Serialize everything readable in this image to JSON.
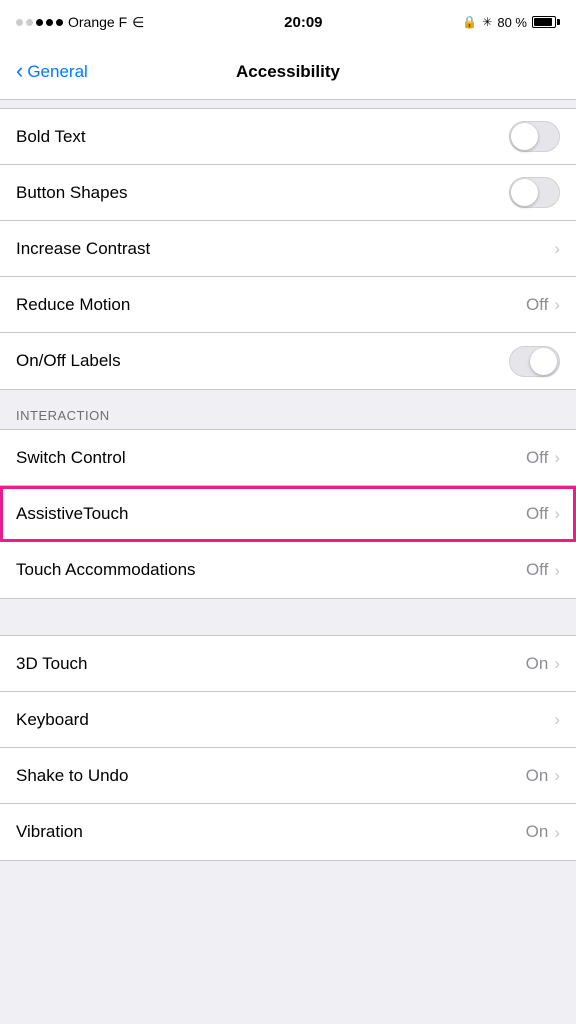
{
  "statusBar": {
    "carrier": "Orange F",
    "time": "20:09",
    "battery": "80 %",
    "batteryPercent": 80
  },
  "navBar": {
    "backLabel": "General",
    "title": "Accessibility"
  },
  "sections": [
    {
      "id": "vision",
      "header": null,
      "items": [
        {
          "id": "bold-text",
          "label": "Bold Text",
          "type": "toggle",
          "value": false,
          "valueLabel": null
        },
        {
          "id": "button-shapes",
          "label": "Button Shapes",
          "type": "toggle",
          "value": false,
          "valueLabel": null
        },
        {
          "id": "increase-contrast",
          "label": "Increase Contrast",
          "type": "chevron",
          "value": null,
          "valueLabel": null
        },
        {
          "id": "reduce-motion",
          "label": "Reduce Motion",
          "type": "chevron",
          "value": null,
          "valueLabel": "Off"
        },
        {
          "id": "onoff-labels",
          "label": "On/Off Labels",
          "type": "toggle-partial",
          "value": false,
          "valueLabel": null
        }
      ]
    },
    {
      "id": "interaction",
      "header": "INTERACTION",
      "items": [
        {
          "id": "switch-control",
          "label": "Switch Control",
          "type": "chevron",
          "value": null,
          "valueLabel": "Off"
        },
        {
          "id": "assistive-touch",
          "label": "AssistiveTouch",
          "type": "chevron",
          "value": null,
          "valueLabel": "Off",
          "highlighted": true
        },
        {
          "id": "touch-accommodations",
          "label": "Touch Accommodations",
          "type": "chevron",
          "value": null,
          "valueLabel": "Off"
        }
      ]
    },
    {
      "id": "physical",
      "header": null,
      "items": [
        {
          "id": "3d-touch",
          "label": "3D Touch",
          "type": "chevron",
          "value": null,
          "valueLabel": "On"
        },
        {
          "id": "keyboard",
          "label": "Keyboard",
          "type": "chevron",
          "value": null,
          "valueLabel": null
        },
        {
          "id": "shake-undo",
          "label": "Shake to Undo",
          "type": "chevron",
          "value": null,
          "valueLabel": "On"
        },
        {
          "id": "vibration",
          "label": "Vibration",
          "type": "chevron",
          "value": null,
          "valueLabel": "On"
        }
      ]
    }
  ]
}
